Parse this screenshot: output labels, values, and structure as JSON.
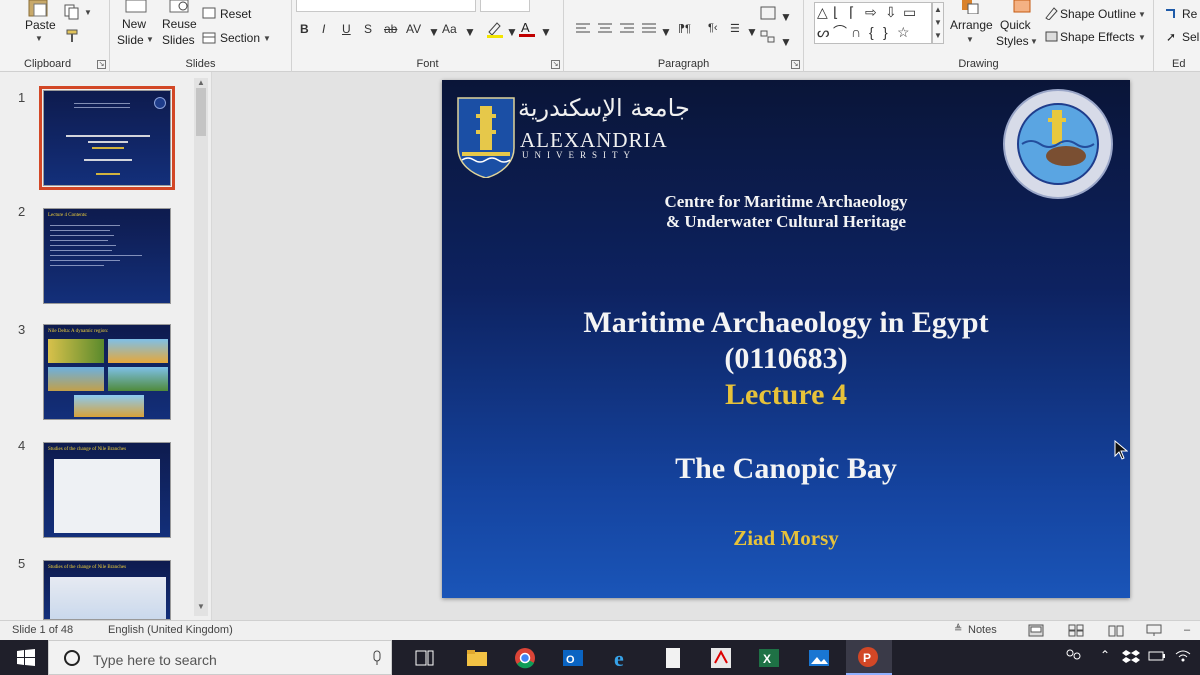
{
  "ribbon": {
    "clipboard": {
      "paste_label": "Paste",
      "group_label": "Clipboard"
    },
    "slides": {
      "new_slide_label": "New\nSlide",
      "new_slide_1": "New",
      "new_slide_2": "Slide",
      "reuse_1": "Reuse",
      "reuse_2": "Slides",
      "reset_label": "Reset",
      "section_label": "Section",
      "group_label": "Slides"
    },
    "font": {
      "bold": "B",
      "italic": "I",
      "underline": "U",
      "shadow": "S",
      "strike": "ab",
      "spacing": "AV",
      "case": "Aa",
      "group_label": "Font"
    },
    "paragraph": {
      "group_label": "Paragraph"
    },
    "drawing": {
      "arrange_label": "Arrange",
      "quick_1": "Quick",
      "quick_2": "Styles",
      "shape_outline": "Shape Outline",
      "shape_effects": "Shape Effects",
      "group_label": "Drawing"
    },
    "editing": {
      "replace": "Re",
      "select": "Sel",
      "group_label": "Ed"
    }
  },
  "thumbnails": [
    {
      "num": "1",
      "title": "Maritime Archaeology in Egypt",
      "selected": true
    },
    {
      "num": "2",
      "title": "Lecture 4 Contents:"
    },
    {
      "num": "3",
      "title": "Nile Delta: A dynamic region:"
    },
    {
      "num": "4",
      "title": "Studies of the change of Nile Branches"
    },
    {
      "num": "5",
      "title": "Studies of the change of Nile Branches"
    }
  ],
  "slide": {
    "logo_arabic": "جامعة الإسكندرية",
    "logo_name": "ALEXANDRIA",
    "logo_sub": "UNIVERSITY",
    "centre_line1": "Centre for Maritime Archaeology",
    "centre_line2": "& Underwater Cultural Heritage",
    "title_line1": "Maritime Archaeology in Egypt",
    "title_line2": "(0110683)",
    "lecture": "Lecture 4",
    "subtitle": "The Canopic Bay",
    "author": "Ziad Morsy",
    "colors": {
      "white": "#f4f4f4",
      "gold": "#e7c23a"
    }
  },
  "status": {
    "slide_info": "Slide 1 of 48",
    "language": "English (United Kingdom)",
    "notes_label": "Notes"
  },
  "taskbar": {
    "search_placeholder": "Type here to search"
  }
}
